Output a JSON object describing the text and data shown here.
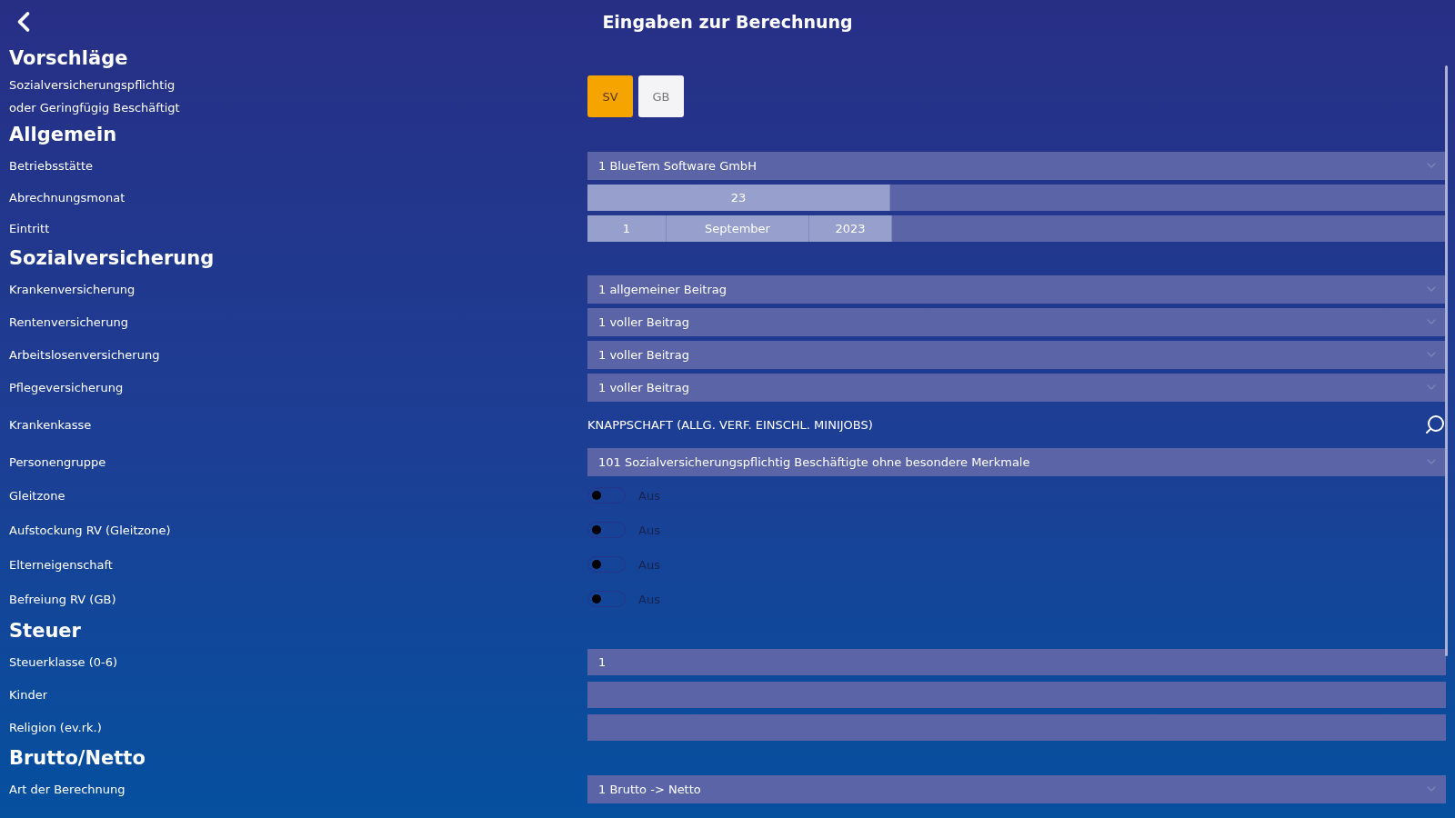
{
  "header": {
    "title": "Eingaben zur Berechnung"
  },
  "sections": [
    {
      "heading": "Vorschläge",
      "subtitle": [
        "Sozialversicherungspflichtig",
        "oder Geringfügig Beschäftigt"
      ],
      "choices": [
        {
          "label": "SV",
          "selected": true
        },
        {
          "label": "GB",
          "selected": false
        }
      ]
    },
    {
      "heading": "Allgemein",
      "rows": [
        {
          "kind": "dropdown",
          "label": "Betriebsstätte",
          "value": "1 BlueTem Software GmbH"
        },
        {
          "kind": "month",
          "label": "Abrechnungsmonat",
          "value": "23"
        },
        {
          "kind": "date",
          "label": "Eintritt",
          "parts": [
            "1",
            "September",
            "2023"
          ]
        }
      ]
    },
    {
      "heading": "Sozialversicherung",
      "rows": [
        {
          "kind": "dropdown",
          "label": "Krankenversicherung",
          "value": "1 allgemeiner Beitrag"
        },
        {
          "kind": "dropdown",
          "label": "Rentenversicherung",
          "value": "1 voller Beitrag"
        },
        {
          "kind": "dropdown",
          "label": "Arbeitslosenversicherung",
          "value": "1 voller Beitrag"
        },
        {
          "kind": "dropdown",
          "label": "Pflegeversicherung",
          "value": "1 voller Beitrag"
        },
        {
          "kind": "lookup",
          "label": "Krankenkasse",
          "value": "KNAPPSCHAFT (ALLG. VERF. EINSCHL. MINIJOBS)"
        },
        {
          "kind": "dropdown",
          "label": "Personengruppe",
          "value": "101 Sozialversicherungspflichtig Beschäftigte ohne besondere Merkmale"
        },
        {
          "kind": "toggle",
          "label": "Gleitzone",
          "on": false,
          "state": "Aus"
        },
        {
          "kind": "toggle",
          "label": "Aufstockung RV (Gleitzone)",
          "on": false,
          "state": "Aus"
        },
        {
          "kind": "toggle",
          "label": "Elterneigenschaft",
          "on": false,
          "state": "Aus"
        },
        {
          "kind": "toggle",
          "label": "Befreiung RV (GB)",
          "on": false,
          "state": "Aus"
        }
      ]
    },
    {
      "heading": "Steuer",
      "rows": [
        {
          "kind": "input",
          "label": "Steuerklasse (0-6)",
          "value": "1"
        },
        {
          "kind": "input",
          "label": "Kinder"
        },
        {
          "kind": "input",
          "label": "Religion (ev.rk.)"
        }
      ]
    },
    {
      "heading": "Brutto/Netto",
      "rows": [
        {
          "kind": "dropdown",
          "label": "Art der Berechnung",
          "value": "1 Brutto -> Netto"
        }
      ]
    }
  ]
}
